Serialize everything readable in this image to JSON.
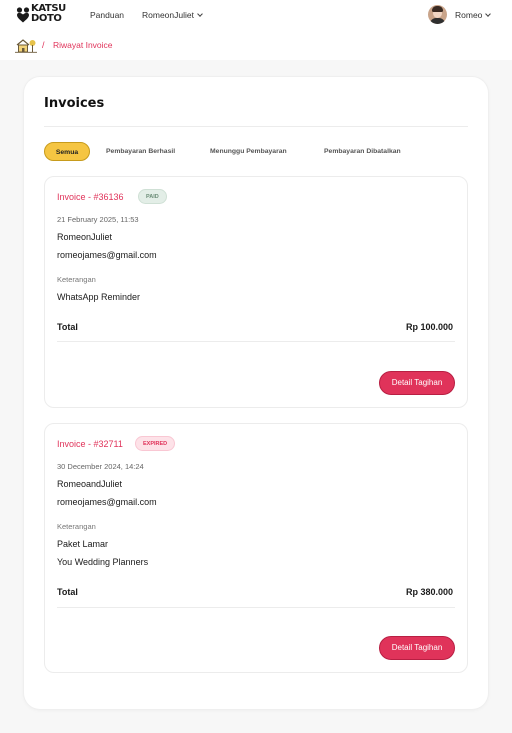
{
  "brand": {
    "logo_line1": "KATSU",
    "logo_line2": "DOTO"
  },
  "nav": {
    "panduan": "Panduan",
    "user_menu": "RomeonJuliet",
    "profile": "Romeo"
  },
  "breadcrumb": {
    "separator": "/",
    "current": "Riwayat Invoice"
  },
  "page": {
    "title": "Invoices"
  },
  "tabs": [
    {
      "label": "Semua",
      "active": true
    },
    {
      "label": "Pembayaran Berhasil",
      "active": false
    },
    {
      "label": "Menunggu Pembayaran",
      "active": false
    },
    {
      "label": "Pembayaran Dibatalkan",
      "active": false
    }
  ],
  "invoices": [
    {
      "id": "Invoice - #36136",
      "status": "PAID",
      "date": "21 February 2025, 11:53",
      "name": "RomeonJuliet",
      "email": "romeojames@gmail.com",
      "desc_label": "Keterangan",
      "desc_lines": [
        "WhatsApp Reminder"
      ],
      "total_label": "Total",
      "total": "Rp 100.000",
      "button": "Detail Tagihan"
    },
    {
      "id": "Invoice - #32711",
      "status": "EXPIRED",
      "date": "30 December 2024, 14:24",
      "name": "RomeoandJuliet",
      "email": "romeojames@gmail.com",
      "desc_label": "Keterangan",
      "desc_lines": [
        "Paket Lamar",
        "You Wedding Planners"
      ],
      "total_label": "Total",
      "total": "Rp 380.000",
      "button": "Detail Tagihan"
    }
  ],
  "colors": {
    "accent": "#e0335a",
    "tab_active": "#f5c542",
    "paid_badge": "#e3eee7",
    "expired_badge": "#fde2e8"
  },
  "icons": [
    "katsudoto-logo-icon",
    "chevron-down-icon",
    "avatar",
    "home-icon"
  ]
}
